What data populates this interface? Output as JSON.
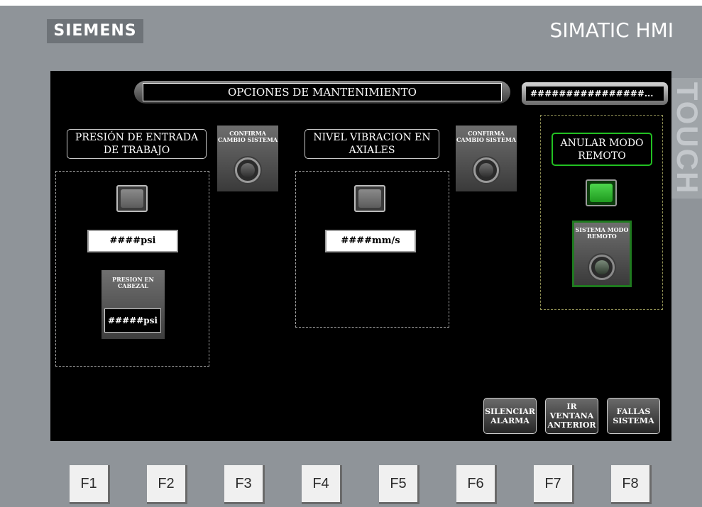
{
  "device": {
    "brand": "SIEMENS",
    "model": "SIMATIC HMI",
    "touch_label": "TOUCH"
  },
  "header": {
    "title": "OPCIONES DE MANTENIMIENTO",
    "status_field": "################..."
  },
  "panels": {
    "pressure": {
      "label": "PRESIÓN DE ENTRADA DE TRABAJO",
      "confirm_button": "CONFIRMA CAMBIO SISTEMA",
      "value": "####psi",
      "head_label": "PRESION EN CABEZAL",
      "head_value": "#####psi"
    },
    "vibration": {
      "label": "NIVEL VIBRACION EN AXIALES",
      "confirm_button": "CONFIRMA CAMBIO SISTEMA",
      "value": "####mm/s"
    },
    "remote": {
      "label": "ANULAR MODO REMOTO",
      "mode_button": "SISTEMA MODO REMOTO",
      "indicator_color": "#33cc33"
    }
  },
  "nav": {
    "silence_alarm": "SILENCIAR ALARMA",
    "previous_window": "IR VENTANA ANTERIOR",
    "system_faults": "FALLAS SISTEMA"
  },
  "function_keys": [
    "F1",
    "F2",
    "F3",
    "F4",
    "F5",
    "F6",
    "F7",
    "F8"
  ],
  "colors": {
    "screen_bg": "#000000",
    "bezel": "#8f9499",
    "accent_green": "#22c022"
  }
}
